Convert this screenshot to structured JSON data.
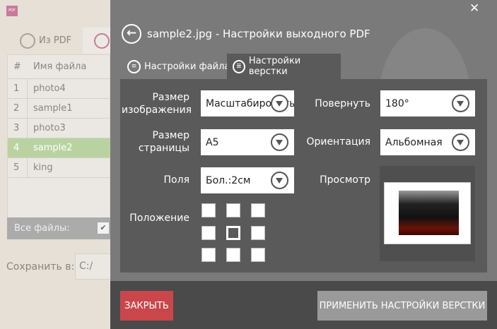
{
  "app": {
    "logo": "PDF"
  },
  "left": {
    "tabs": [
      {
        "label": "Из PDF",
        "icon": "from-pdf-icon"
      },
      {
        "label": "",
        "icon": "to-pdf-icon"
      }
    ],
    "table": {
      "headers": [
        "#",
        "Имя файла"
      ],
      "rows": [
        [
          "1",
          "photo4"
        ],
        [
          "2",
          "sample1"
        ],
        [
          "3",
          "photo3"
        ],
        [
          "4",
          "sample2"
        ],
        [
          "5",
          "king"
        ]
      ],
      "selected_index": 3
    },
    "all_files_label": "Все файлы:",
    "all_files_checked": true,
    "save_label": "Сохранить в:",
    "save_value": "C:/"
  },
  "dialog": {
    "title": "sample2.jpg - Настройки выходного PDF",
    "tabs": [
      {
        "label": "Настройки файла"
      },
      {
        "label": "Настройки верстки",
        "active": true
      }
    ],
    "fields": {
      "image_size": {
        "label": "Размер изображения",
        "value": "Масштабировать"
      },
      "page_size": {
        "label": "Размер страницы",
        "value": "A5"
      },
      "margins": {
        "label": "Поля",
        "value": "Бол.:2см"
      },
      "rotate": {
        "label": "Повернуть",
        "value": "180°"
      },
      "orientation": {
        "label": "Ориентация",
        "value": "Альбомная"
      },
      "preview_label": "Просмотр",
      "position": {
        "label": "Положение",
        "selected": "center"
      }
    },
    "close_button": "ЗАКРЫТЬ",
    "apply_button": "ПРИМЕНИТЬ НАСТРОЙКИ ВЕРСТКИ",
    "colors": {
      "close": "#c9474a",
      "apply": "#9a9a9a",
      "selected_row": "#b9d3a0"
    }
  }
}
